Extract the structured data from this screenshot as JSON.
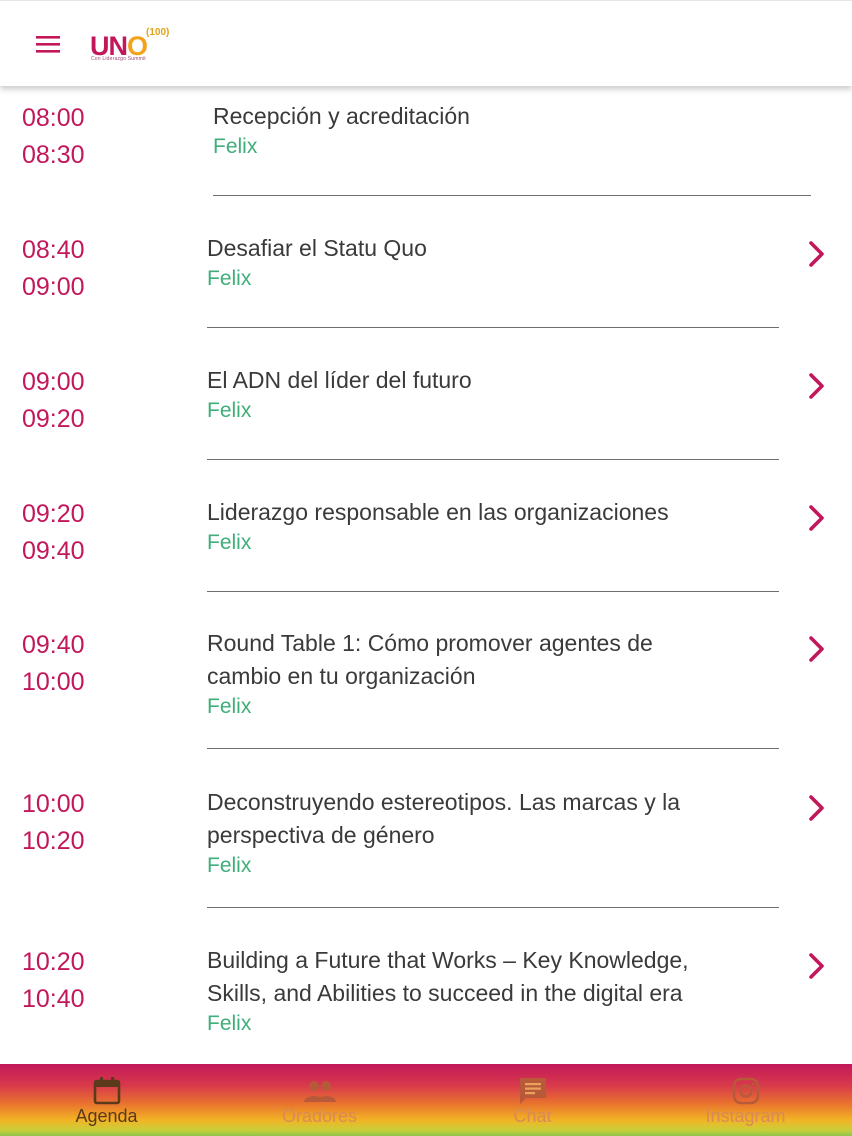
{
  "header": {
    "logo_text_main": "UN",
    "logo_text_o": "O",
    "logo_superscript": "(100)",
    "logo_subtitle": "Con Liderazgo Summit"
  },
  "colors": {
    "accent": "#c2185b",
    "speaker": "#3fae7a",
    "title": "#3a3a3a"
  },
  "agenda": {
    "items": [
      {
        "start": "08:00",
        "end": "08:30",
        "title_lines": [
          "Recepción y acreditación"
        ],
        "speaker": "Felix",
        "has_detail": false
      },
      {
        "start": "08:40",
        "end": "09:00",
        "title_lines": [
          "Desafiar el Statu Quo"
        ],
        "speaker": "Felix",
        "has_detail": true
      },
      {
        "start": "09:00",
        "end": "09:20",
        "title_lines": [
          "El ADN del líder del futuro"
        ],
        "speaker": "Felix",
        "has_detail": true
      },
      {
        "start": "09:20",
        "end": "09:40",
        "title_lines": [
          "Liderazgo responsable en las organizaciones"
        ],
        "speaker": "Felix",
        "has_detail": true
      },
      {
        "start": "09:40",
        "end": "10:00",
        "title_lines": [
          "Round Table 1: Cómo promover agentes de",
          "cambio en tu organización"
        ],
        "speaker": "Felix",
        "has_detail": true
      },
      {
        "start": "10:00",
        "end": "10:20",
        "title_lines": [
          "Deconstruyendo estereotipos. Las marcas y la",
          "perspectiva de género"
        ],
        "speaker": "Felix",
        "has_detail": true
      },
      {
        "start": "10:20",
        "end": "10:40",
        "title_lines": [
          "Building a Future that Works – Key Knowledge,",
          "Skills, and Abilities to succeed in the digital era"
        ],
        "speaker": "Felix",
        "has_detail": true
      }
    ]
  },
  "bottom_nav": {
    "items": [
      {
        "label": "Agenda",
        "icon": "calendar-icon",
        "active": true
      },
      {
        "label": "Oradores",
        "icon": "people-icon",
        "active": false
      },
      {
        "label": "Chat",
        "icon": "chat-icon",
        "active": false
      },
      {
        "label": "Instagram",
        "icon": "instagram-icon",
        "active": false
      }
    ]
  }
}
